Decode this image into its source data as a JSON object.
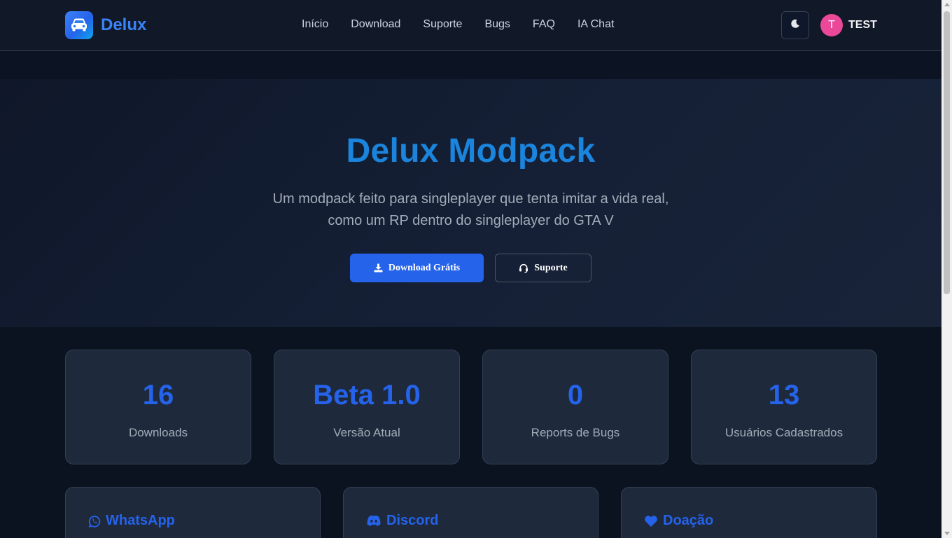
{
  "brand": {
    "name": "Delux",
    "icon": "car-icon"
  },
  "nav": {
    "links": [
      "Início",
      "Download",
      "Suporte",
      "Bugs",
      "FAQ",
      "IA Chat"
    ]
  },
  "header": {
    "theme_icon": "moon-icon",
    "user": {
      "initial": "T",
      "name": "TEST"
    }
  },
  "hero": {
    "title": "Delux Modpack",
    "subtitle_line1": "Um modpack feito para singleplayer que tenta imitar a vida real,",
    "subtitle_line2": "como um RP dentro do singleplayer do GTA V",
    "primary_button": "Download Grátis",
    "secondary_button": "Suporte"
  },
  "stats": [
    {
      "value": "16",
      "label": "Downloads"
    },
    {
      "value": "Beta 1.0",
      "label": "Versão Atual"
    },
    {
      "value": "0",
      "label": "Reports de Bugs"
    },
    {
      "value": "13",
      "label": "Usuários Cadastrados"
    }
  ],
  "cards": [
    {
      "title": "WhatsApp",
      "icon": "whatsapp-icon"
    },
    {
      "title": "Discord",
      "icon": "discord-icon"
    },
    {
      "title": "Doação",
      "icon": "heart-icon"
    }
  ],
  "colors": {
    "accent": "#2563eb",
    "hero_title": "#1b84dc",
    "avatar": "#ec4899",
    "background": "#0b1220",
    "card": "#1e293b"
  }
}
